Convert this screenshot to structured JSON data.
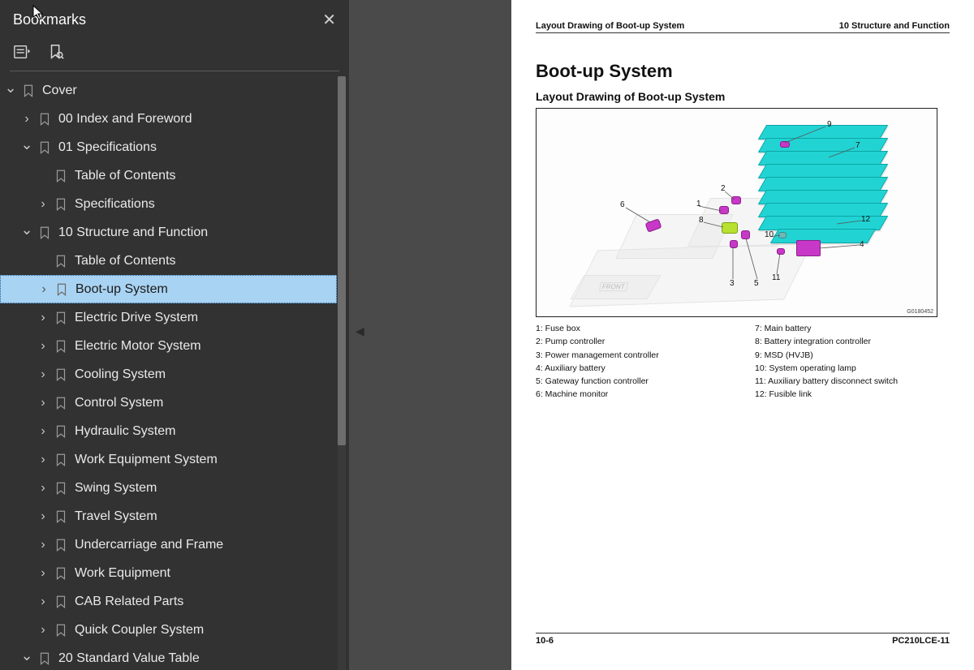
{
  "sidebar": {
    "title": "Bookmarks",
    "tree": [
      {
        "id": "cover",
        "label": "Cover",
        "level": 0,
        "expander": "down",
        "bookmark": true
      },
      {
        "id": "00-index",
        "label": "00 Index and Foreword",
        "level": 1,
        "expander": "right",
        "bookmark": true
      },
      {
        "id": "01-spec",
        "label": "01 Specifications",
        "level": 1,
        "expander": "down",
        "bookmark": true
      },
      {
        "id": "01-toc",
        "label": "Table of Contents",
        "level": 2,
        "expander": "none",
        "bookmark": true
      },
      {
        "id": "01-specifications",
        "label": "Specifications",
        "level": 2,
        "expander": "right",
        "bookmark": true
      },
      {
        "id": "10-sf",
        "label": "10 Structure and Function",
        "level": 1,
        "expander": "down",
        "bookmark": true
      },
      {
        "id": "10-toc",
        "label": "Table of Contents",
        "level": 2,
        "expander": "none",
        "bookmark": true
      },
      {
        "id": "10-bootup",
        "label": "Boot-up System",
        "level": 2,
        "expander": "right",
        "bookmark": true,
        "selected": true,
        "dim": true
      },
      {
        "id": "10-eds",
        "label": "Electric Drive System",
        "level": 2,
        "expander": "right",
        "bookmark": true
      },
      {
        "id": "10-ems",
        "label": "Electric Motor System",
        "level": 2,
        "expander": "right",
        "bookmark": true
      },
      {
        "id": "10-cooling",
        "label": "Cooling System",
        "level": 2,
        "expander": "right",
        "bookmark": true
      },
      {
        "id": "10-control",
        "label": "Control System",
        "level": 2,
        "expander": "right",
        "bookmark": true
      },
      {
        "id": "10-hydraulic",
        "label": "Hydraulic System",
        "level": 2,
        "expander": "right",
        "bookmark": true
      },
      {
        "id": "10-workeq",
        "label": "Work Equipment System",
        "level": 2,
        "expander": "right",
        "bookmark": true
      },
      {
        "id": "10-swing",
        "label": "Swing System",
        "level": 2,
        "expander": "right",
        "bookmark": true
      },
      {
        "id": "10-travel",
        "label": "Travel System",
        "level": 2,
        "expander": "right",
        "bookmark": true
      },
      {
        "id": "10-under",
        "label": "Undercarriage and Frame",
        "level": 2,
        "expander": "right",
        "bookmark": true
      },
      {
        "id": "10-we",
        "label": "Work Equipment",
        "level": 2,
        "expander": "right",
        "bookmark": true
      },
      {
        "id": "10-cab",
        "label": "CAB Related Parts",
        "level": 2,
        "expander": "right",
        "bookmark": true
      },
      {
        "id": "10-quick",
        "label": "Quick Coupler System",
        "level": 2,
        "expander": "right",
        "bookmark": true
      },
      {
        "id": "20-svt",
        "label": "20 Standard Value Table",
        "level": 1,
        "expander": "down",
        "bookmark": true
      }
    ]
  },
  "page": {
    "header_left": "Layout Drawing of Boot-up System",
    "header_right": "10 Structure and Function",
    "h1": "Boot-up System",
    "h2": "Layout Drawing of Boot-up System",
    "figure_id": "G0180452",
    "front_tag": "FRONT",
    "legend_left": [
      "1: Fuse box",
      "2: Pump controller",
      "3: Power management controller",
      "4: Auxiliary battery",
      "5: Gateway function controller",
      "6: Machine monitor"
    ],
    "legend_right": [
      "7: Main battery",
      "8: Battery integration controller",
      "9: MSD (HVJB)",
      "10: System operating lamp",
      "11: Auxiliary battery disconnect switch",
      "12: Fusible link"
    ],
    "callouts": [
      "1",
      "2",
      "3",
      "4",
      "5",
      "6",
      "7",
      "8",
      "9",
      "10",
      "11",
      "12"
    ],
    "footer_left": "10-6",
    "footer_right": "PC210LCE-11"
  }
}
